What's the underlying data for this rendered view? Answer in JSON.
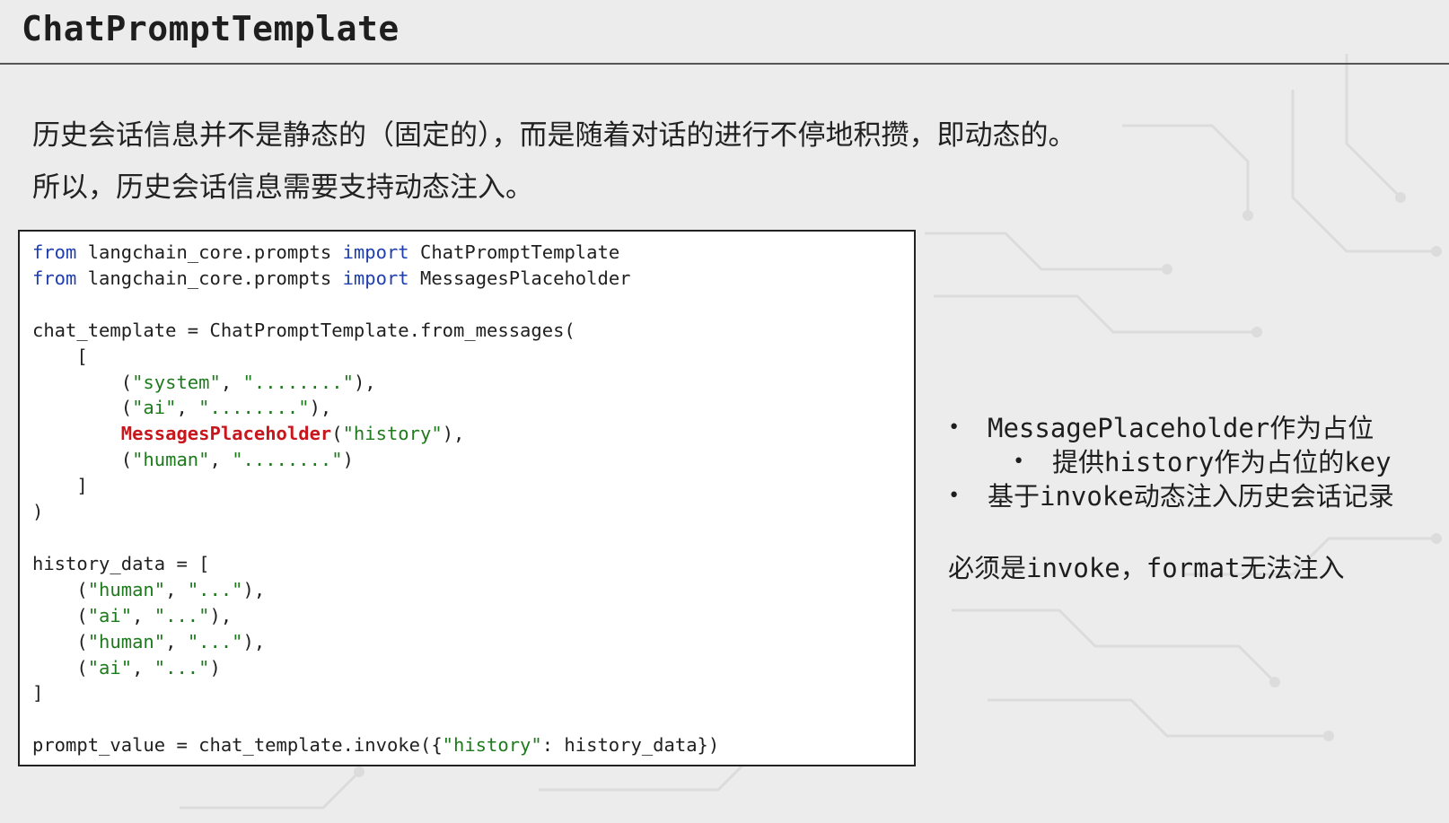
{
  "slide": {
    "title": "ChatPromptTemplate",
    "intro_lines": [
      "历史会话信息并不是静态的（固定的），而是随着对话的进行不停地积攒，即动态的。",
      "所以，历史会话信息需要支持动态注入。"
    ]
  },
  "code": {
    "lines": [
      [
        {
          "t": "from",
          "c": "kw"
        },
        {
          "t": " langchain_core.prompts "
        },
        {
          "t": "import",
          "c": "kw"
        },
        {
          "t": " ChatPromptTemplate"
        }
      ],
      [
        {
          "t": "from",
          "c": "kw"
        },
        {
          "t": " langchain_core.prompts "
        },
        {
          "t": "import",
          "c": "kw"
        },
        {
          "t": " MessagesPlaceholder"
        }
      ],
      [],
      [
        {
          "t": "chat_template = ChatPromptTemplate.from_messages("
        }
      ],
      [
        {
          "t": "    ["
        }
      ],
      [
        {
          "t": "        ("
        },
        {
          "t": "\"system\"",
          "c": "str"
        },
        {
          "t": ", "
        },
        {
          "t": "\"........\"",
          "c": "str"
        },
        {
          "t": "),"
        }
      ],
      [
        {
          "t": "        ("
        },
        {
          "t": "\"ai\"",
          "c": "str"
        },
        {
          "t": ", "
        },
        {
          "t": "\"........\"",
          "c": "str"
        },
        {
          "t": "),"
        }
      ],
      [
        {
          "t": "        "
        },
        {
          "t": "MessagesPlaceholder",
          "c": "hl"
        },
        {
          "t": "("
        },
        {
          "t": "\"history\"",
          "c": "str"
        },
        {
          "t": "),"
        }
      ],
      [
        {
          "t": "        ("
        },
        {
          "t": "\"human\"",
          "c": "str"
        },
        {
          "t": ", "
        },
        {
          "t": "\"........\"",
          "c": "str"
        },
        {
          "t": ")"
        }
      ],
      [
        {
          "t": "    ]"
        }
      ],
      [
        {
          "t": ")"
        }
      ],
      [],
      [
        {
          "t": "history_data = ["
        }
      ],
      [
        {
          "t": "    ("
        },
        {
          "t": "\"human\"",
          "c": "str"
        },
        {
          "t": ", "
        },
        {
          "t": "\"...\"",
          "c": "str"
        },
        {
          "t": "),"
        }
      ],
      [
        {
          "t": "    ("
        },
        {
          "t": "\"ai\"",
          "c": "str"
        },
        {
          "t": ", "
        },
        {
          "t": "\"...\"",
          "c": "str"
        },
        {
          "t": "),"
        }
      ],
      [
        {
          "t": "    ("
        },
        {
          "t": "\"human\"",
          "c": "str"
        },
        {
          "t": ", "
        },
        {
          "t": "\"...\"",
          "c": "str"
        },
        {
          "t": "),"
        }
      ],
      [
        {
          "t": "    ("
        },
        {
          "t": "\"ai\"",
          "c": "str"
        },
        {
          "t": ", "
        },
        {
          "t": "\"...\"",
          "c": "str"
        },
        {
          "t": ")"
        }
      ],
      [
        {
          "t": "]"
        }
      ],
      [],
      [
        {
          "t": "prompt_value = chat_template.invoke({"
        },
        {
          "t": "\"history\"",
          "c": "str"
        },
        {
          "t": ": history_data})"
        }
      ]
    ]
  },
  "notes": {
    "bullets": [
      {
        "level": 1,
        "text": "MessagePlaceholder作为占位"
      },
      {
        "level": 2,
        "text": "提供history作为占位的key"
      },
      {
        "level": 1,
        "text": "基于invoke动态注入历史会话记录"
      }
    ],
    "extra": "必须是invoke，format无法注入",
    "bullet_glyph": "•"
  },
  "colors": {
    "keyword": "#1f3fb0",
    "string": "#1d7a1d",
    "highlight": "#c8161d",
    "background": "#ececec"
  }
}
